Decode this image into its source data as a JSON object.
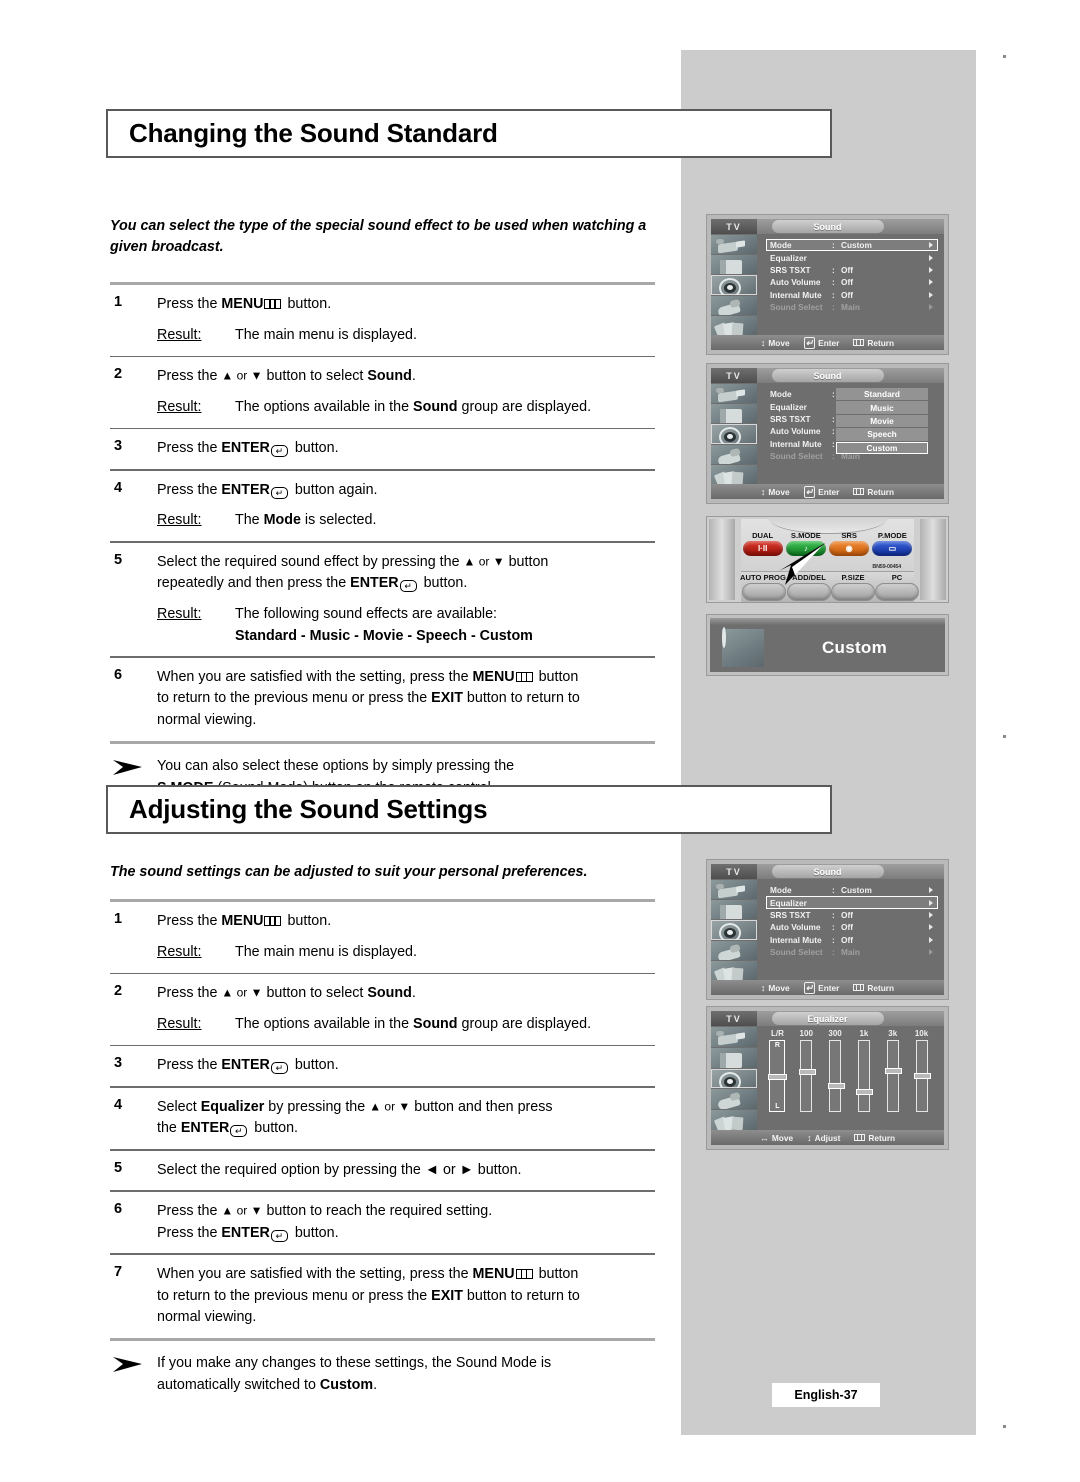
{
  "page": {
    "footer_label": "English-37"
  },
  "sections": [
    {
      "heading": "Changing the Sound Standard",
      "intro": "You can select the type of the special sound effect to be used when watching a given broadcast.",
      "steps": [
        {
          "num": "1",
          "text_before": "Press the ",
          "bold1": "MENU",
          "icon": "menu-icon",
          "text_after": " button.",
          "result_label": "Result:",
          "result_text": "The main menu is displayed."
        },
        {
          "num": "2",
          "text_before": "Press the ",
          "updown": "▲ or ▼",
          "text_mid": " button to select ",
          "bold1": "Sound",
          "text_after": ".",
          "result_label": "Result:",
          "result_text": "The options available in the Sound group are displayed."
        },
        {
          "num": "3",
          "text_before": "Press the ",
          "bold1": "ENTER",
          "icon": "enter-icon",
          "text_after": " button."
        },
        {
          "num": "4",
          "text_before": "Press the ",
          "bold1": "ENTER",
          "icon": "enter-icon",
          "text_after": " button again.",
          "result_label": "Result:",
          "result_text": "The Mode is selected."
        },
        {
          "num": "5",
          "text_before": "Select the required sound effect by pressing the ▲ or ▼ button repeatedly and then press the ",
          "bold1": "ENTER",
          "icon": "enter-icon",
          "text_after": " button.",
          "result_label": "Result:",
          "result_text": "The following sound effects are available:",
          "result_bold_line": "Standard - Music - Movie - Speech - Custom"
        },
        {
          "num": "6",
          "text_before": "When you are satisfied with the setting, press the ",
          "bold1": "MENU",
          "icon": "menu-icon",
          "text_after": " button to return to the previous menu or press the EXIT button to return to normal viewing."
        }
      ],
      "note": "You can also select these options by simply pressing the S.MODE (Sound Mode) button on the remote control."
    },
    {
      "heading": "Adjusting the Sound Settings",
      "intro": "The sound settings can be adjusted to suit your personal preferences.",
      "steps": [
        {
          "num": "1",
          "text_before": "Press the ",
          "bold1": "MENU",
          "icon": "menu-icon",
          "text_after": " button.",
          "result_label": "Result:",
          "result_text": "The main menu is displayed."
        },
        {
          "num": "2",
          "text_before": "Press the ",
          "updown": "▲ or ▼",
          "text_mid": " button to select ",
          "bold1": "Sound",
          "text_after": ".",
          "result_label": "Result:",
          "result_text": "The options available in the Sound group are displayed."
        },
        {
          "num": "3",
          "text_before": "Press the ",
          "bold1": "ENTER",
          "icon": "enter-icon",
          "text_after": " button."
        },
        {
          "num": "4",
          "text_before": "Select Equalizer by pressing the ▲ or ▼ button and then press the ",
          "bold1": "ENTER",
          "icon": "enter-icon",
          "text_after": " button."
        },
        {
          "num": "5",
          "text_before": "Select the required option by pressing the ◄ or ► button."
        },
        {
          "num": "6",
          "text_before": "Press the ▲ or ▼ button to reach the required setting. Press the ",
          "bold1": "ENTER",
          "icon": "enter-icon",
          "text_after": " button."
        },
        {
          "num": "7",
          "text_before": "When you are satisfied with the setting, press the ",
          "bold1": "MENU",
          "icon": "menu-icon",
          "text_after": " button to return to the previous menu or press the EXIT button to return to normal viewing."
        }
      ],
      "note": "If you make any changes to these settings, the Sound Mode is automatically switched to Custom."
    }
  ],
  "osd_screens": [
    {
      "id": "sound-mode-menu",
      "tv_label": "TV",
      "title": "Sound",
      "rows": [
        {
          "label": "Mode",
          "colon": ":",
          "value": "Custom",
          "highlighted": true,
          "dim": false,
          "arrow": true
        },
        {
          "label": "Equalizer",
          "colon": "",
          "value": "",
          "highlighted": false,
          "dim": false,
          "arrow": true
        },
        {
          "label": "SRS TSXT",
          "colon": ":",
          "value": "Off",
          "highlighted": false,
          "dim": false,
          "arrow": true
        },
        {
          "label": "Auto Volume",
          "colon": ":",
          "value": "Off",
          "highlighted": false,
          "dim": false,
          "arrow": true
        },
        {
          "label": "Internal Mute",
          "colon": ":",
          "value": "Off",
          "highlighted": false,
          "dim": false,
          "arrow": true
        },
        {
          "label": "Sound Select",
          "colon": ":",
          "value": "Main",
          "highlighted": false,
          "dim": true,
          "arrow": true
        }
      ],
      "footer": {
        "move": "Move",
        "enter": "Enter",
        "return": "Return"
      }
    },
    {
      "id": "sound-mode-dropdown",
      "tv_label": "TV",
      "title": "Sound",
      "rows": [
        {
          "label": "Mode",
          "colon": ":",
          "value": "",
          "highlighted": false,
          "dim": false,
          "arrow": false
        },
        {
          "label": "Equalizer",
          "colon": "",
          "value": "",
          "highlighted": false,
          "dim": false,
          "arrow": false
        },
        {
          "label": "SRS TSXT",
          "colon": ":",
          "value": "",
          "highlighted": false,
          "dim": false,
          "arrow": false
        },
        {
          "label": "Auto Volume",
          "colon": ":",
          "value": "",
          "highlighted": false,
          "dim": false,
          "arrow": false
        },
        {
          "label": "Internal Mute",
          "colon": ":",
          "value": "",
          "highlighted": false,
          "dim": false,
          "arrow": false
        },
        {
          "label": "Sound Select",
          "colon": ":",
          "value": "Main",
          "highlighted": false,
          "dim": true,
          "arrow": false
        }
      ],
      "dropdown_options": [
        {
          "label": "Standard",
          "selected": false
        },
        {
          "label": "Music",
          "selected": false
        },
        {
          "label": "Movie",
          "selected": false
        },
        {
          "label": "Speech",
          "selected": false
        },
        {
          "label": "Custom",
          "selected": true
        }
      ],
      "footer": {
        "move": "Move",
        "enter": "Enter",
        "return": "Return"
      }
    },
    {
      "id": "sound-equalizer-menu",
      "tv_label": "TV",
      "title": "Sound",
      "rows": [
        {
          "label": "Mode",
          "colon": ":",
          "value": "Custom",
          "highlighted": false,
          "dim": false,
          "arrow": true
        },
        {
          "label": "Equalizer",
          "colon": "",
          "value": "",
          "highlighted": true,
          "dim": false,
          "arrow": true
        },
        {
          "label": "SRS TSXT",
          "colon": ":",
          "value": "Off",
          "highlighted": false,
          "dim": false,
          "arrow": true
        },
        {
          "label": "Auto Volume",
          "colon": ":",
          "value": "Off",
          "highlighted": false,
          "dim": false,
          "arrow": true
        },
        {
          "label": "Internal Mute",
          "colon": ":",
          "value": "Off",
          "highlighted": false,
          "dim": false,
          "arrow": true
        },
        {
          "label": "Sound Select",
          "colon": ":",
          "value": "Main",
          "highlighted": false,
          "dim": true,
          "arrow": true
        }
      ],
      "footer": {
        "move": "Move",
        "enter": "Enter",
        "return": "Return"
      }
    }
  ],
  "equalizer_screen": {
    "id": "equalizer-panel",
    "tv_label": "TV",
    "title": "Equalizer",
    "balance": {
      "label": "L/R",
      "top_label": "R",
      "bottom_label": "L",
      "position_pct": 50
    },
    "bands": [
      {
        "label": "100",
        "position_pct": 42
      },
      {
        "label": "300",
        "position_pct": 63
      },
      {
        "label": "1k",
        "position_pct": 72
      },
      {
        "label": "3k",
        "position_pct": 41
      },
      {
        "label": "10k",
        "position_pct": 47
      }
    ],
    "footer": {
      "move": "Move",
      "adjust": "Adjust",
      "return": "Return"
    }
  },
  "remote": {
    "top_buttons": [
      {
        "label": "DUAL",
        "key_text": "I·II",
        "color": "#c22017"
      },
      {
        "label": "S.MODE",
        "key_text": "♪",
        "color": "#1f9e33"
      },
      {
        "label": "SRS",
        "key_text": "◉",
        "color": "#e2731a"
      },
      {
        "label": "P.MODE",
        "key_text": "▭",
        "color": "#1b49c4"
      }
    ],
    "bottom_buttons": [
      {
        "label": "AUTO PROG."
      },
      {
        "label": "ADD/DEL"
      },
      {
        "label": "P.SIZE"
      },
      {
        "label": "PC"
      }
    ],
    "part_number": "BN59-00454"
  },
  "banner": {
    "id": "custom-banner",
    "label": "Custom",
    "icon": "speaker-icon"
  }
}
